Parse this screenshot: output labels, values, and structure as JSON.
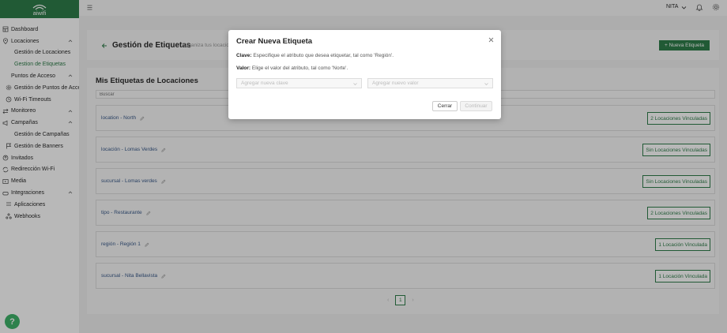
{
  "brand": {
    "logo_text": "aiwifi",
    "color": "#2f7d4a"
  },
  "header": {
    "user_name": "NITA",
    "icons": [
      "menu-icon",
      "chevron-down-icon",
      "bell-icon",
      "gear-icon"
    ]
  },
  "sidebar": {
    "items": [
      {
        "label": "Dashboard",
        "icon": "dashboard-icon",
        "level": "top"
      },
      {
        "label": "Locaciones",
        "icon": "location-pin-icon",
        "level": "top",
        "expanded": true
      },
      {
        "label": "Gestión de Locaciones",
        "level": "sub"
      },
      {
        "label": "Gestion de Etiquetas",
        "level": "sub",
        "active": true
      },
      {
        "label": "Puntos de Acceso",
        "level": "top",
        "expanded": true
      },
      {
        "label": "Gestión de Puntos de Acceso",
        "level": "sub",
        "icon": "gear-icon"
      },
      {
        "label": "Wi-Fi Timeouts",
        "level": "sub",
        "icon": "clock-icon"
      },
      {
        "label": "Monitoreo",
        "icon": "arrows-icon",
        "level": "top",
        "expanded": true
      },
      {
        "label": "Campañas",
        "icon": "megaphone-icon",
        "level": "top",
        "expanded": true
      },
      {
        "label": "Gestión de Campañas",
        "level": "sub"
      },
      {
        "label": "Gestión de Banners",
        "level": "sub",
        "icon": "flag-icon"
      },
      {
        "label": "Invitados",
        "icon": "guests-icon",
        "level": "top"
      },
      {
        "label": "Redirección Wi-Fi",
        "icon": "redirect-icon",
        "level": "top"
      },
      {
        "label": "Media",
        "icon": "media-icon",
        "level": "top"
      },
      {
        "label": "Integraciones",
        "icon": "integrations-icon",
        "level": "top",
        "expanded": true
      },
      {
        "label": "Aplicaciones",
        "level": "sub",
        "icon": "grid-icon"
      },
      {
        "label": "Webhooks",
        "level": "sub",
        "icon": "webhook-icon"
      }
    ]
  },
  "page": {
    "title": "Gestión de Etiquetas",
    "subtitle": "Organiza tus locaciones",
    "new_button": "+ Nueva Etiqueta"
  },
  "section": {
    "title": "Mis Etiquetas de Locaciones",
    "search_placeholder": "Buscar",
    "tags": [
      {
        "label": "location - North",
        "badge": "2 Locaciones Vinculadas"
      },
      {
        "label": "locación - Lomas Verdes",
        "badge": "Sin Locaciones Vinculadas"
      },
      {
        "label": "sucursal - Lomas verdes",
        "badge": "Sin Locaciones Vinculadas"
      },
      {
        "label": "tipo - Restaurante",
        "badge": "2 Locaciones Vinculadas"
      },
      {
        "label": "región - Región 1",
        "badge": "1 Locación Vinculada"
      },
      {
        "label": "sucursal - Nita Bellavista",
        "badge": "1 Locación Vinculada"
      }
    ]
  },
  "pagination": {
    "prev": "‹",
    "current": "1",
    "next": "›"
  },
  "modal": {
    "title": "Crear Nueva Etiqueta",
    "clave_label": "Clave:",
    "clave_text": " Especifique el atributo que desea etiquetar, tal como 'Región'.",
    "valor_label": "Valor:",
    "valor_text": " Elige el valor del atributo, tal como 'Norte'.",
    "key_placeholder": "Agregar nueva clave",
    "value_placeholder": "Agregar nuevo valor",
    "cancel_label": "Cerrar",
    "continue_label": "Continuar"
  }
}
